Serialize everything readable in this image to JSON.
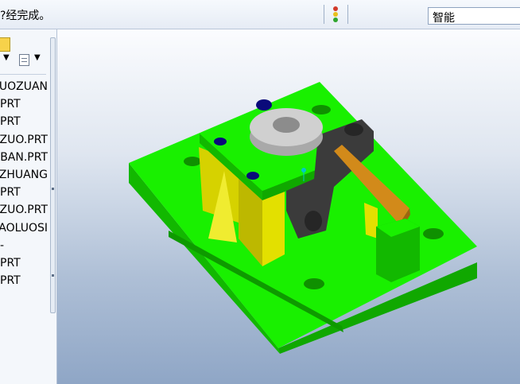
{
  "statusbar": {
    "message": "?经完成。",
    "traffic_light": "traffic-light-icon",
    "filter_value": "智能"
  },
  "model_tree": {
    "settings_icon": "settings-dropdown-icon",
    "view_icon": "tree-view-icon",
    "items": [
      "UZUOZUAN",
      "PRT",
      "PRT",
      "DINGZUO.PRT",
      "DIBAN.PRT",
      "GONGZHUANG",
      "PRT",
      "ZUO.PRT",
      "LAOLUOSI",
      "-",
      "PRT",
      "PRT"
    ]
  },
  "viewport": {
    "model_colors": {
      "base": "#19f000",
      "base_side": "#12b800",
      "yellow": "#e3e000",
      "dark_part": "#3b3b3b",
      "washer": "#c9c9c9",
      "lever": "#d28a1a",
      "pin": "#0a0a7a"
    }
  }
}
